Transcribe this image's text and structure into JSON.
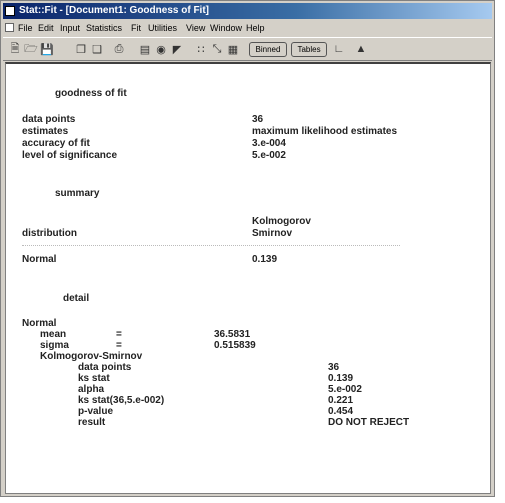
{
  "window": {
    "title": "Stat::Fit - [Document1: Goodness of Fit]",
    "menu": [
      "File",
      "Edit",
      "Input",
      "Statistics",
      "Fit",
      "Utilities",
      "View",
      "Window",
      "Help"
    ],
    "toolbar_buttons": [
      "Binned",
      "Tables"
    ]
  },
  "report": {
    "header": "goodness of fit",
    "params": [
      {
        "label": "data points",
        "value": "36"
      },
      {
        "label": "estimates",
        "value": "maximum likelihood estimates"
      },
      {
        "label": "accuracy of fit",
        "value": "3.e-004"
      },
      {
        "label": "level of significance",
        "value": "5.e-002"
      }
    ],
    "summary": {
      "title": "summary",
      "col_header_1": "Kolmogorov",
      "col_header_2": "Smirnov",
      "row_label": "distribution",
      "rows": [
        {
          "name": "Normal",
          "value": "0.139"
        }
      ]
    },
    "detail": {
      "title": "detail",
      "dist": "Normal",
      "params": [
        {
          "name": "mean",
          "sym": "=",
          "value": "36.5831"
        },
        {
          "name": "sigma",
          "sym": "=",
          "value": "0.515839"
        }
      ],
      "test": "Kolmogorov-Smirnov",
      "test_rows": [
        {
          "label": "data points",
          "value": "36"
        },
        {
          "label": "ks stat",
          "value": "0.139"
        },
        {
          "label": "alpha",
          "value": "5.e-002"
        },
        {
          "label": "ks stat(36,5.e-002)",
          "value": "0.221"
        },
        {
          "label": "p-value",
          "value": "0.454"
        },
        {
          "label": "result",
          "value": "DO NOT REJECT"
        }
      ]
    }
  }
}
